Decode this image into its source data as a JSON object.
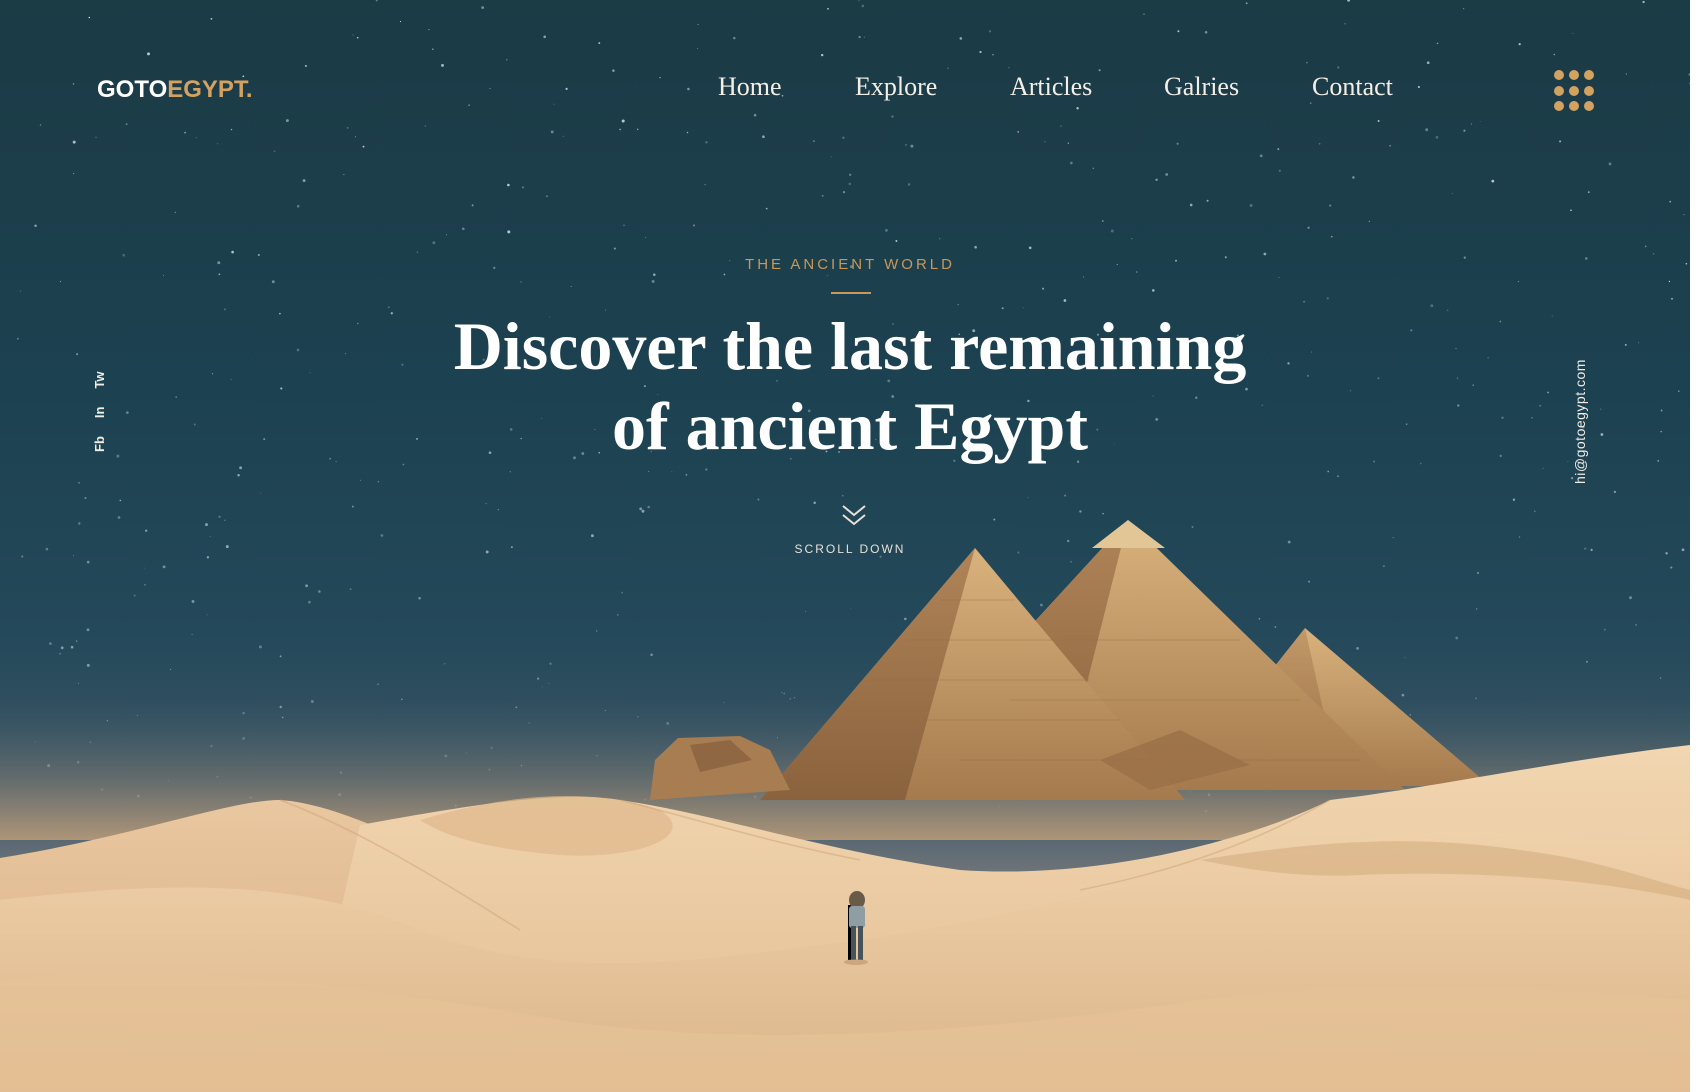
{
  "brand": {
    "logo_primary": "GOTO",
    "logo_accent": "EGYPT."
  },
  "nav": {
    "items": [
      "Home",
      "Explore",
      "Articles",
      "Galries",
      "Contact"
    ]
  },
  "menu": {
    "icon": "grid-menu-icon"
  },
  "social": {
    "items": [
      "Fb",
      "In",
      "Tw"
    ]
  },
  "contact": {
    "email": "hi@gotoegypt.com"
  },
  "hero": {
    "eyebrow": "THE ANCIENT WORLD",
    "headline_line1": "Discover the last remaining",
    "headline_line2": "of ancient Egypt",
    "scroll_label": "SCROLL DOWN",
    "scroll_icon": "double-chevron-down-icon"
  },
  "colors": {
    "accent": "#d4a260",
    "sky": "#1c4150",
    "sand": "#e6c49a",
    "text": "#ffffff"
  }
}
